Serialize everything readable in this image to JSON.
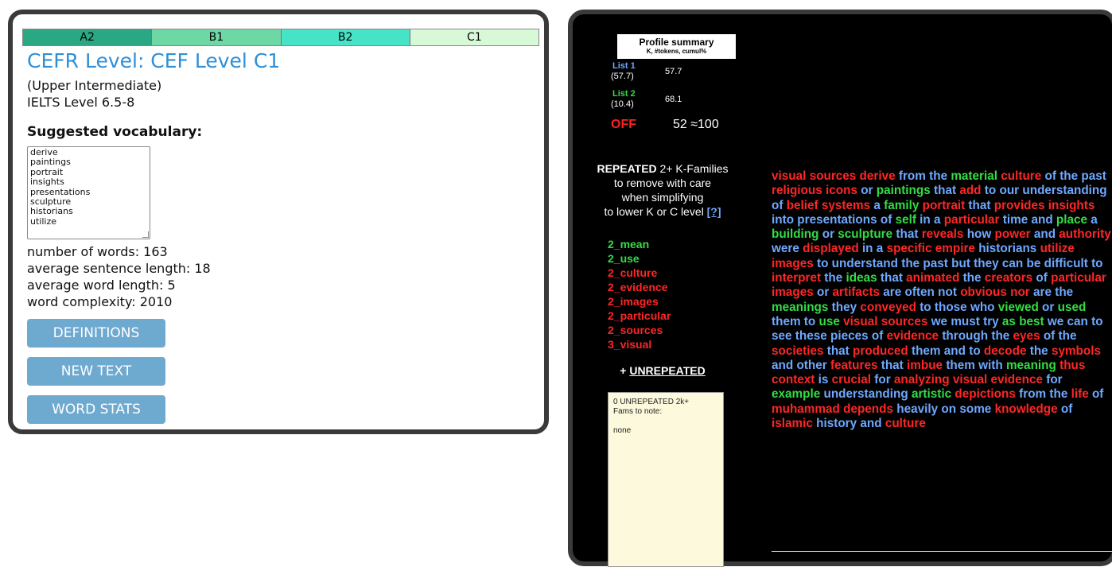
{
  "left": {
    "levels": [
      {
        "label": "A2",
        "color": "#2aa884"
      },
      {
        "label": "B1",
        "color": "#6ed8a4"
      },
      {
        "label": "B2",
        "color": "#46e3c6"
      },
      {
        "label": "C1",
        "color": "#d7f9d8"
      }
    ],
    "cefr_title": "CEFR Level: CEF Level C1",
    "level_desc": "(Upper Intermediate)",
    "ielts": "IELTS Level 6.5-8",
    "suggested_heading": "Suggested vocabulary:",
    "vocabulary": [
      "derive",
      "paintings",
      "portrait",
      "insights",
      "presentations",
      "sculpture",
      "historians",
      "utilize"
    ],
    "stats": [
      "number of words: 163",
      "average sentence length: 18",
      "average word length: 5",
      "word complexity: 2010"
    ],
    "buttons": {
      "definitions": "DEFINITIONS",
      "new_text": "NEW TEXT",
      "word_stats": "WORD STATS"
    }
  },
  "right": {
    "profile": {
      "title": "Profile summary",
      "subtitle": "K, #tokens, cumul%"
    },
    "lists": [
      {
        "label": "List 1",
        "pct": "(57.7)",
        "cumul": "57.7",
        "color": "#6fa8ff"
      },
      {
        "label": "List 2",
        "pct": "(10.4)",
        "cumul": "68.1",
        "color": "#33dd44"
      }
    ],
    "off": {
      "label": "OFF",
      "value": "52 ≈100"
    },
    "repeated": {
      "bold": "REPEATED",
      "line1_rest": " 2+ K-Families",
      "line2": "to remove with care",
      "line3": "when simplifying",
      "line4": "to lower K or C level",
      "help": "[?]"
    },
    "families": [
      {
        "text": "2_mean",
        "color": "#33dd44"
      },
      {
        "text": "2_use",
        "color": "#33dd44"
      },
      {
        "text": "2_culture",
        "color": "#ff2626"
      },
      {
        "text": "2_evidence",
        "color": "#ff2626"
      },
      {
        "text": "2_images",
        "color": "#ff2626"
      },
      {
        "text": "2_particular",
        "color": "#ff2626"
      },
      {
        "text": "2_sources",
        "color": "#ff2626"
      },
      {
        "text": "3_visual",
        "color": "#ff2626"
      }
    ],
    "unrepeated": {
      "plus": "+ ",
      "word": "UNREPEATED",
      "box_line1": "0 UNREPEATED 2k+",
      "box_line2": "Fams to note:",
      "box_none": "none"
    },
    "analysis_tokens": [
      [
        "visual",
        "r"
      ],
      [
        "sources",
        "r"
      ],
      [
        "derive",
        "r"
      ],
      [
        "from",
        "b"
      ],
      [
        "the",
        "b"
      ],
      [
        "material",
        "g"
      ],
      [
        "culture",
        "r"
      ],
      [
        "of",
        "b"
      ],
      [
        "the",
        "b"
      ],
      [
        "past",
        "b"
      ],
      [
        "religious",
        "r"
      ],
      [
        "icons",
        "r"
      ],
      [
        "or",
        "b"
      ],
      [
        "paintings",
        "g"
      ],
      [
        "that",
        "b"
      ],
      [
        "add",
        "r"
      ],
      [
        "to",
        "b"
      ],
      [
        "our",
        "b"
      ],
      [
        "understanding",
        "b"
      ],
      [
        "of",
        "b"
      ],
      [
        "belief",
        "r"
      ],
      [
        "systems",
        "r"
      ],
      [
        "a",
        "b"
      ],
      [
        "family",
        "g"
      ],
      [
        "portrait",
        "r"
      ],
      [
        "that",
        "b"
      ],
      [
        "provides",
        "r"
      ],
      [
        "insights",
        "r"
      ],
      [
        "into",
        "b"
      ],
      [
        "presentations",
        "b"
      ],
      [
        "of",
        "b"
      ],
      [
        "self",
        "g"
      ],
      [
        "in",
        "b"
      ],
      [
        "a",
        "b"
      ],
      [
        "particular",
        "r"
      ],
      [
        "time",
        "b"
      ],
      [
        "and",
        "b"
      ],
      [
        "place",
        "g"
      ],
      [
        "a",
        "b"
      ],
      [
        "building",
        "g"
      ],
      [
        "or",
        "b"
      ],
      [
        "sculpture",
        "g"
      ],
      [
        "that",
        "b"
      ],
      [
        "reveals",
        "r"
      ],
      [
        "how",
        "b"
      ],
      [
        "power",
        "r"
      ],
      [
        "and",
        "b"
      ],
      [
        "authority",
        "r"
      ],
      [
        "were",
        "b"
      ],
      [
        "displayed",
        "r"
      ],
      [
        "in",
        "b"
      ],
      [
        "a",
        "b"
      ],
      [
        "specific",
        "r"
      ],
      [
        "empire",
        "r"
      ],
      [
        "historians",
        "b"
      ],
      [
        "utilize",
        "r"
      ],
      [
        "images",
        "r"
      ],
      [
        "to",
        "b"
      ],
      [
        "understand",
        "b"
      ],
      [
        "the",
        "b"
      ],
      [
        "past",
        "b"
      ],
      [
        "but",
        "b"
      ],
      [
        "they",
        "b"
      ],
      [
        "can",
        "b"
      ],
      [
        "be",
        "b"
      ],
      [
        "difficult",
        "b"
      ],
      [
        "to",
        "b"
      ],
      [
        "interpret",
        "r"
      ],
      [
        "the",
        "b"
      ],
      [
        "ideas",
        "g"
      ],
      [
        "that",
        "b"
      ],
      [
        "animated",
        "r"
      ],
      [
        "the",
        "b"
      ],
      [
        "creators",
        "r"
      ],
      [
        "of",
        "b"
      ],
      [
        "particular",
        "r"
      ],
      [
        "images",
        "r"
      ],
      [
        "or",
        "b"
      ],
      [
        "artifacts",
        "r"
      ],
      [
        "are",
        "b"
      ],
      [
        "often",
        "b"
      ],
      [
        "not",
        "b"
      ],
      [
        "obvious",
        "r"
      ],
      [
        "nor",
        "r"
      ],
      [
        "are",
        "b"
      ],
      [
        "the",
        "b"
      ],
      [
        "meanings",
        "g"
      ],
      [
        "they",
        "b"
      ],
      [
        "conveyed",
        "r"
      ],
      [
        "to",
        "b"
      ],
      [
        "those",
        "b"
      ],
      [
        "who",
        "b"
      ],
      [
        "viewed",
        "g"
      ],
      [
        "or",
        "b"
      ],
      [
        "used",
        "g"
      ],
      [
        "them",
        "b"
      ],
      [
        "to",
        "b"
      ],
      [
        "use",
        "g"
      ],
      [
        "visual",
        "r"
      ],
      [
        "sources",
        "r"
      ],
      [
        "we",
        "b"
      ],
      [
        "must",
        "b"
      ],
      [
        "try",
        "b"
      ],
      [
        "as",
        "g"
      ],
      [
        "best",
        "g"
      ],
      [
        "we",
        "b"
      ],
      [
        "can",
        "b"
      ],
      [
        "to",
        "b"
      ],
      [
        "see",
        "b"
      ],
      [
        "these",
        "b"
      ],
      [
        "pieces",
        "b"
      ],
      [
        "of",
        "b"
      ],
      [
        "evidence",
        "r"
      ],
      [
        "through",
        "b"
      ],
      [
        "the",
        "b"
      ],
      [
        "eyes",
        "r"
      ],
      [
        "of",
        "b"
      ],
      [
        "the",
        "b"
      ],
      [
        "societies",
        "r"
      ],
      [
        "that",
        "b"
      ],
      [
        "produced",
        "r"
      ],
      [
        "them",
        "b"
      ],
      [
        "and",
        "b"
      ],
      [
        "to",
        "b"
      ],
      [
        "decode",
        "r"
      ],
      [
        "the",
        "b"
      ],
      [
        "symbols",
        "r"
      ],
      [
        "and",
        "b"
      ],
      [
        "other",
        "b"
      ],
      [
        "features",
        "r"
      ],
      [
        "that",
        "b"
      ],
      [
        "imbue",
        "r"
      ],
      [
        "them",
        "b"
      ],
      [
        "with",
        "b"
      ],
      [
        "meaning",
        "g"
      ],
      [
        "thus",
        "r"
      ],
      [
        "context",
        "r"
      ],
      [
        "is",
        "b"
      ],
      [
        "crucial",
        "r"
      ],
      [
        "for",
        "b"
      ],
      [
        "analyzing",
        "r"
      ],
      [
        "visual",
        "r"
      ],
      [
        "evidence",
        "r"
      ],
      [
        "for",
        "b"
      ],
      [
        "example",
        "g"
      ],
      [
        "understanding",
        "b"
      ],
      [
        "artistic",
        "g"
      ],
      [
        "depictions",
        "r"
      ],
      [
        "from",
        "b"
      ],
      [
        "the",
        "b"
      ],
      [
        "life",
        "r"
      ],
      [
        "of",
        "b"
      ],
      [
        "muhammad",
        "r"
      ],
      [
        "depends",
        "r"
      ],
      [
        "heavily",
        "b"
      ],
      [
        "on",
        "b"
      ],
      [
        "some",
        "b"
      ],
      [
        "knowledge",
        "r"
      ],
      [
        "of",
        "b"
      ],
      [
        "islamic",
        "r"
      ],
      [
        "history",
        "b"
      ],
      [
        "and",
        "b"
      ],
      [
        "culture",
        "r"
      ]
    ]
  }
}
